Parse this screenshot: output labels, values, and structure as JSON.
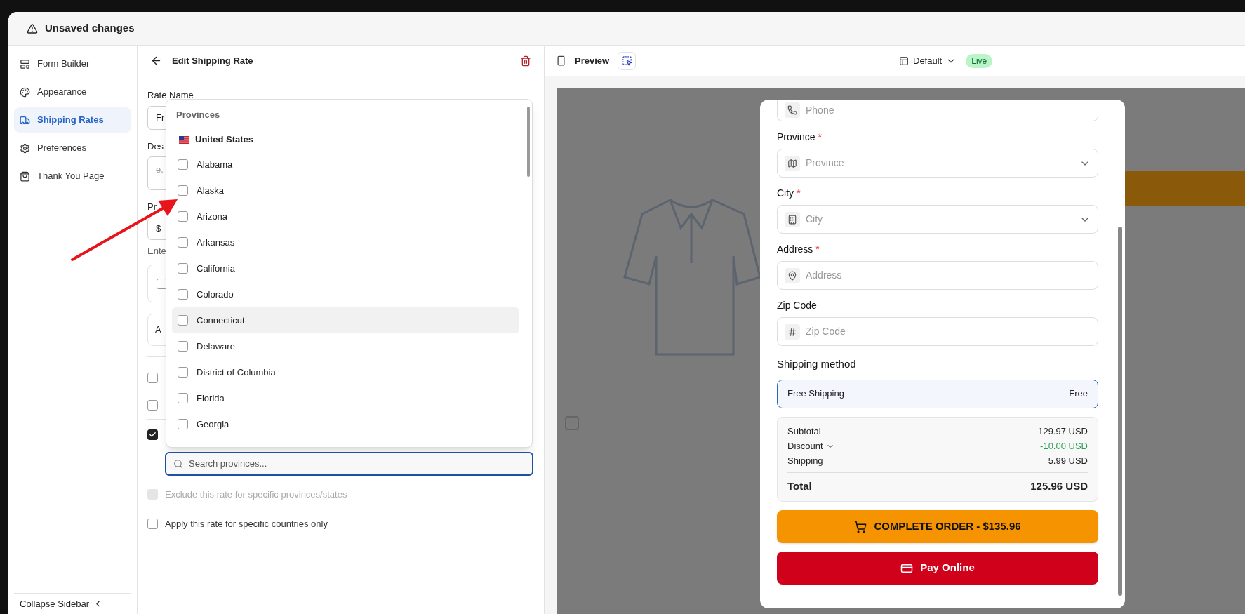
{
  "window": {
    "title": "Unsaved changes"
  },
  "sidebar": {
    "items": [
      {
        "label": "Form Builder",
        "selected": false
      },
      {
        "label": "Appearance",
        "selected": false
      },
      {
        "label": "Shipping Rates",
        "selected": true
      },
      {
        "label": "Preferences",
        "selected": false
      },
      {
        "label": "Thank You Page",
        "selected": false
      }
    ],
    "collapse": "Collapse Sidebar"
  },
  "editor": {
    "title": "Edit Shipping Rate",
    "rate_name_label": "Rate Name",
    "rate_name_value": "Fr",
    "description_label": "Des",
    "description_placeholder": "e.",
    "price_label": "Pr",
    "price_prefix": "$",
    "price_hint": "Ente",
    "option_card": {
      "checked": false
    },
    "add_card": {
      "text": "A"
    },
    "hidden_options": [
      {
        "checked": false
      },
      {
        "checked": false
      },
      {
        "checked": true
      }
    ],
    "exclude": {
      "label": "Exclude this rate for specific provinces/states",
      "checked": false,
      "disabled": true
    },
    "countries": {
      "label": "Apply this rate for specific countries only",
      "checked": false,
      "disabled": false
    }
  },
  "provinces_dropdown": {
    "title": "Provinces",
    "country": "United States",
    "search_placeholder": "Search provinces...",
    "items": [
      {
        "label": "Alabama",
        "checked": false,
        "hovered": false
      },
      {
        "label": "Alaska",
        "checked": false,
        "hovered": false
      },
      {
        "label": "Arizona",
        "checked": false,
        "hovered": false
      },
      {
        "label": "Arkansas",
        "checked": false,
        "hovered": false
      },
      {
        "label": "California",
        "checked": false,
        "hovered": false
      },
      {
        "label": "Colorado",
        "checked": false,
        "hovered": false
      },
      {
        "label": "Connecticut",
        "checked": false,
        "hovered": true
      },
      {
        "label": "Delaware",
        "checked": false,
        "hovered": false
      },
      {
        "label": "District of Columbia",
        "checked": false,
        "hovered": false
      },
      {
        "label": "Florida",
        "checked": false,
        "hovered": false
      },
      {
        "label": "Georgia",
        "checked": false,
        "hovered": false
      }
    ]
  },
  "preview": {
    "title": "Preview",
    "template": "Default",
    "status": "Live",
    "form": {
      "fields": [
        {
          "placeholder": "Phone",
          "dropdown": false
        },
        {
          "label": "Province",
          "required_mark": "*",
          "placeholder": "Province",
          "dropdown": true
        },
        {
          "label": "City",
          "required_mark": "*",
          "placeholder": "City",
          "dropdown": true
        },
        {
          "label": "Address",
          "required_mark": "*",
          "placeholder": "Address",
          "dropdown": false
        },
        {
          "label": "Zip Code",
          "placeholder": "Zip Code",
          "dropdown": false
        }
      ],
      "shipping_title": "Shipping method",
      "shipping_options": [
        {
          "name": "Free Shipping",
          "price": "Free",
          "selected": true
        }
      ],
      "summary": [
        {
          "kind": "line",
          "label": "Subtotal",
          "value": "129.97 USD"
        },
        {
          "kind": "discount",
          "label": "Discount",
          "value": "-10.00 USD"
        },
        {
          "kind": "line",
          "label": "Shipping",
          "value": "5.99 USD"
        },
        {
          "kind": "total",
          "label": "Total",
          "value": "125.96 USD"
        }
      ],
      "complete_button": "COMPLETE ORDER - $135.96",
      "pay_button": "Pay Online"
    }
  }
}
